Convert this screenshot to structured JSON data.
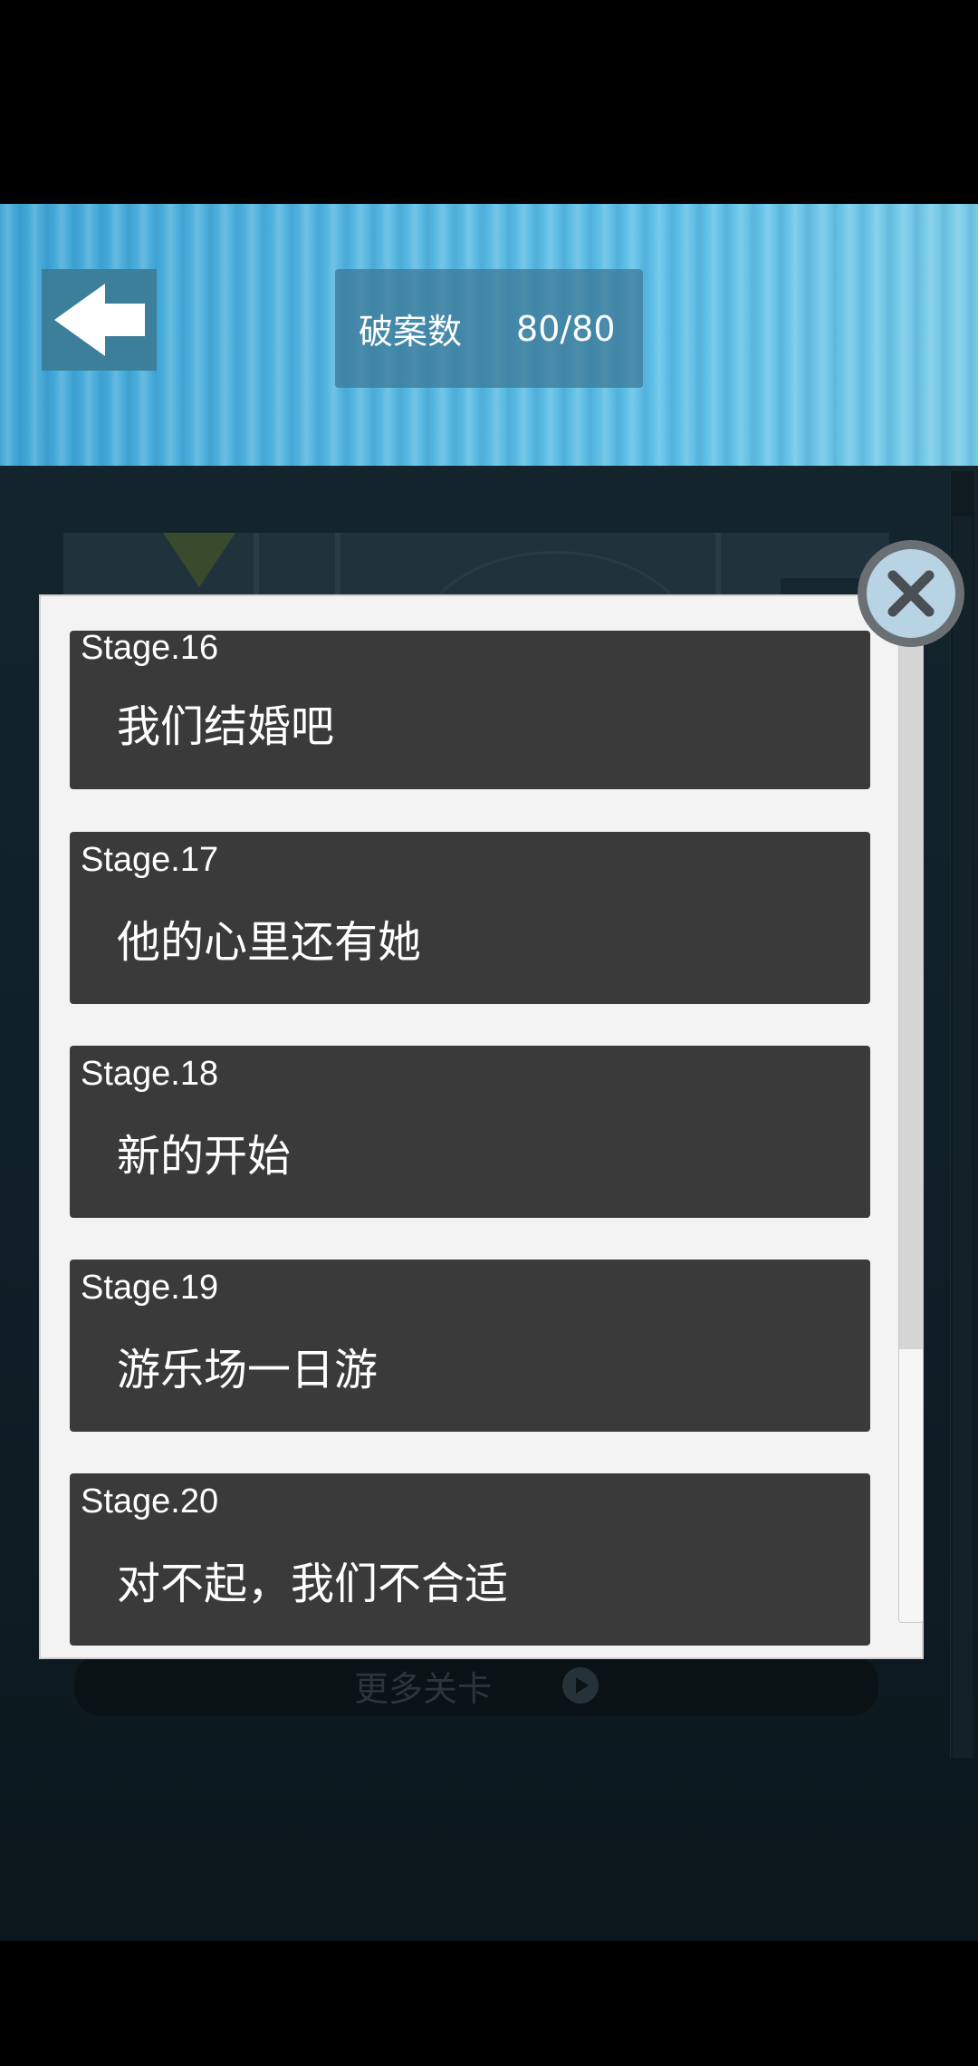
{
  "header": {
    "back_icon": "left-arrow-icon",
    "case_count_label": "破案数",
    "case_count_value": "80/80"
  },
  "stages": [
    {
      "number": "Stage.16",
      "title": "我们结婚吧"
    },
    {
      "number": "Stage.17",
      "title": "他的心里还有她"
    },
    {
      "number": "Stage.18",
      "title": "新的开始"
    },
    {
      "number": "Stage.19",
      "title": "游乐场一日游"
    },
    {
      "number": "Stage.20",
      "title": "对不起，我们不合适"
    }
  ],
  "more_stages_label": "更多关卡",
  "close_icon": "close-icon",
  "colors": {
    "header_blue": "#55b7e1",
    "card_bg": "#3a3a3a",
    "popup_bg": "#f3f3f3",
    "close_fill": "#b7d3e4"
  }
}
